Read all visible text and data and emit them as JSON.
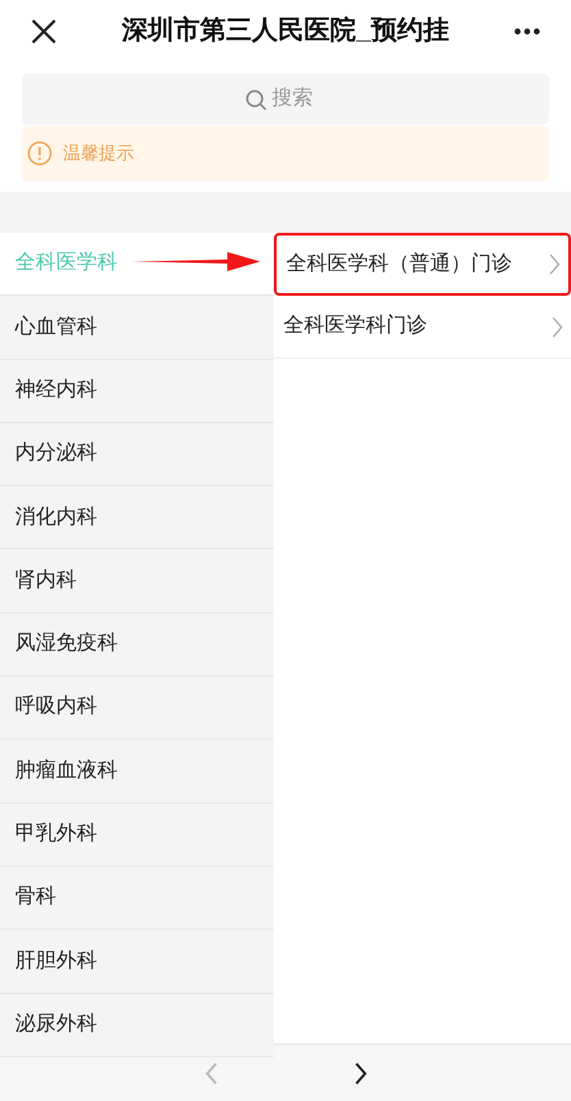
{
  "window": {
    "title": "深圳市第三人民医院_预约挂"
  },
  "search": {
    "placeholder": "搜索"
  },
  "notice": {
    "text": "温馨提示"
  },
  "departments": [
    {
      "label": "全科医学科",
      "selected": true
    },
    {
      "label": "心血管科",
      "selected": false
    },
    {
      "label": "神经内科",
      "selected": false
    },
    {
      "label": "内分泌科",
      "selected": false
    },
    {
      "label": "消化内科",
      "selected": false
    },
    {
      "label": "肾内科",
      "selected": false
    },
    {
      "label": "风湿免疫科",
      "selected": false
    },
    {
      "label": "呼吸内科",
      "selected": false
    },
    {
      "label": "肿瘤血液科",
      "selected": false
    },
    {
      "label": "甲乳外科",
      "selected": false
    },
    {
      "label": "骨科",
      "selected": false
    },
    {
      "label": "肝胆外科",
      "selected": false
    },
    {
      "label": "泌尿外科",
      "selected": false
    }
  ],
  "clinics": [
    {
      "label": "全科医学科（普通）门诊",
      "highlighted": true
    },
    {
      "label": "全科医学科门诊",
      "highlighted": false
    }
  ],
  "nav": [
    {
      "kind": "back",
      "disabled": true
    },
    {
      "kind": "forward",
      "disabled": false
    }
  ]
}
